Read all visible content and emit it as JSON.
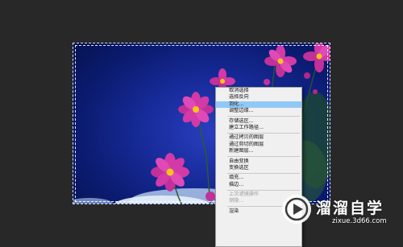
{
  "context_menu": {
    "groups": [
      [
        "取消选择",
        "选择反向",
        "羽化...",
        "调整边缘..."
      ],
      [
        "存储选区...",
        "建立工作路径..."
      ],
      [
        "通过拷贝的图层",
        "通过剪切的图层",
        "新建图层..."
      ],
      [
        "自由变换",
        "变换选区"
      ],
      [
        "填充...",
        "描边..."
      ],
      [
        "上次滤镜操作",
        "渐隐..."
      ],
      [
        "渲染"
      ]
    ],
    "highlighted_item": "羽化...",
    "disabled_items": [
      "上次滤镜操作",
      "渐隐..."
    ]
  },
  "watermark": {
    "title": "溜溜自学",
    "url": "zixue.3d66.com"
  },
  "colors": {
    "workspace_bg": "#282828",
    "menu_bg": "#f0f0f0",
    "menu_highlight": "#90c8f6",
    "sky_blue": "#172b9a",
    "flower_pink": "#d23aa8"
  }
}
